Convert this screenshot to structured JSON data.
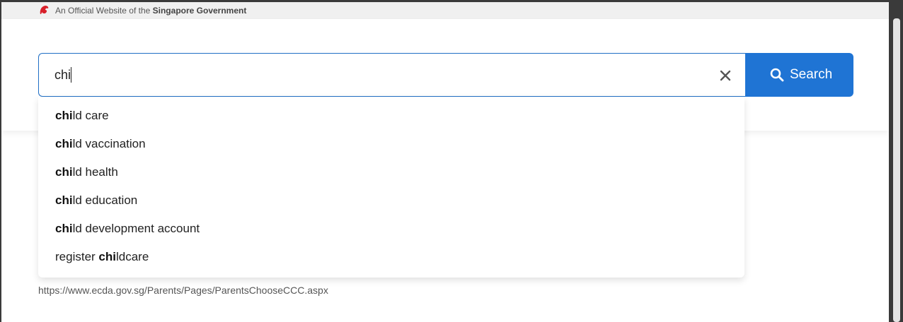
{
  "masthead": {
    "prefix": "An Official Website of the",
    "emphasis": "Singapore Government"
  },
  "search": {
    "value": "chi",
    "button_label": "Search",
    "clear_icon": "close-icon",
    "search_icon": "search-icon"
  },
  "suggestions": [
    {
      "before": "",
      "match": "chi",
      "after": "ld care"
    },
    {
      "before": "",
      "match": "chi",
      "after": "ld vaccination"
    },
    {
      "before": "",
      "match": "chi",
      "after": "ld health"
    },
    {
      "before": "",
      "match": "chi",
      "after": "ld education"
    },
    {
      "before": "",
      "match": "chi",
      "after": "ld development account"
    },
    {
      "before": "register ",
      "match": "chi",
      "after": "ldcare"
    }
  ],
  "result": {
    "url": "https://www.ecda.gov.sg/Parents/Pages/ParentsChooseCCC.aspx"
  },
  "colors": {
    "accent": "#1f74d4",
    "input_border": "#1f6fc5",
    "masthead_bg": "#f0f0f0"
  }
}
